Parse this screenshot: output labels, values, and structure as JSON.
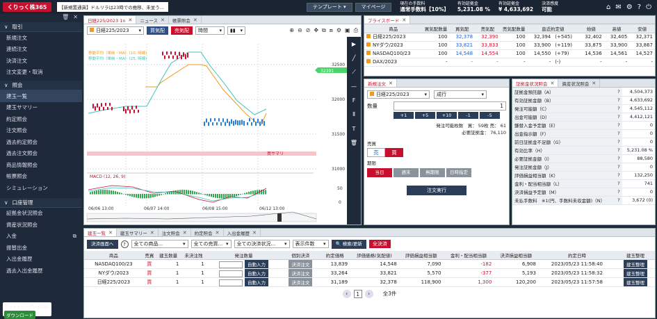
{
  "header": {
    "logo": "くりっく株365",
    "ticker": "【新規置通貨】ドルリラは23時での推移、未並う...",
    "template_btn": "テンプレート ▾",
    "mypage_btn": "マイページ",
    "stats": [
      {
        "label": "現在の手数料",
        "value": "通常手数料【10%】"
      },
      {
        "label": "有効証拠金",
        "value": "5,231.08 %"
      },
      {
        "label": "有効証拠金",
        "value": "¥ 4,633,692"
      },
      {
        "label": "決済感度",
        "value": "可能"
      }
    ]
  },
  "sidebar": {
    "sections": [
      {
        "title": "取引",
        "items": [
          "新規注文",
          "連続注文",
          "決済注文",
          "注文変更・取消"
        ]
      },
      {
        "title": "照会",
        "items": [
          "建玉一覧",
          "建玉サマリー",
          "約定照会",
          "注文照会",
          "過去約定照会",
          "過去注文照会",
          "商品情報照会",
          "帳票照会",
          "シミュレーション"
        ]
      },
      {
        "title": "口座管理",
        "items": [
          "証拠金状況照会",
          "資産状況照会",
          "入金",
          "振替出金",
          "入出金履歴",
          "過去入出金履歴"
        ]
      }
    ],
    "download_title": "ネットトレーダー株365",
    "download_btn": "ダウンロード"
  },
  "chart_panel": {
    "tabs": [
      "日経225/2023 1n",
      "ニュース",
      "帳票照会"
    ],
    "product": "日経225/2023",
    "ask_btn": "買気配",
    "bid_btn": "売気配",
    "period": "時間",
    "legend": [
      "移動平均（単純・MA）（10, 時線)",
      "移動平均（単純・MA）（25, 時線)"
    ],
    "macd_label": "MACD (12, 26, 9)",
    "yticks": [
      "32500",
      "32000",
      "31500",
      "31000"
    ],
    "macd_ticks": [
      "50",
      "0"
    ],
    "xticks": [
      "06/06 13:00",
      "06/07 14:00",
      "06/08 15:00",
      "06/12 13:00"
    ],
    "current_price": "32391",
    "stop_label": "買サマリ"
  },
  "price_board": {
    "tab": "プライスボード",
    "headers": [
      "商品",
      "買気配数量",
      "買気配",
      "売気配",
      "売気配数量",
      "直近約定値",
      "始値",
      "高値",
      "安値"
    ],
    "rows": [
      [
        "日経225/2023",
        "100",
        "32,378",
        "32,390",
        "100",
        "32,394",
        "(+545)",
        "32,402",
        "32,405",
        "32,371"
      ],
      [
        "NYダウ/2023",
        "100",
        "33,821",
        "33,833",
        "100",
        "33,900",
        "(+119)",
        "33,875",
        "33,900",
        "33,867"
      ],
      [
        "NASDAQ100/23",
        "100",
        "14,548",
        "14,554",
        "100",
        "14,550",
        "(+79)",
        "14,536",
        "14,561",
        "14,527"
      ],
      [
        "DAX/2023",
        "-",
        "-",
        "-",
        "-",
        "-",
        "(-)",
        "-",
        "-",
        "-"
      ]
    ]
  },
  "order_panel": {
    "tab": "新規注文",
    "product": "日経225/2023",
    "type": "成行",
    "qty_label": "数量",
    "qty": "1",
    "steps": [
      "+1",
      "+5",
      "+10",
      "-1",
      "-5"
    ],
    "avail_label": "発注可能枚数　買：",
    "avail_value": "59枚 売：",
    "avail_sell": "61",
    "margin_label": "必要証拠金：",
    "margin_value": "76,110",
    "side_label": "売買",
    "sell": "売",
    "buy": "買",
    "expiry_label": "期限",
    "expiry": [
      "当日",
      "週末",
      "無期限",
      "日時指定"
    ],
    "submit": "注文実行"
  },
  "margin_panel": {
    "tabs": [
      "証拠金状況照会",
      "資産状況照会"
    ],
    "rows": [
      [
        "証拠金預託額（A）",
        "4,504,373"
      ],
      [
        "有効証拠金額（B）",
        "4,633,692"
      ],
      [
        "発注可能額（C）",
        "4,545,112"
      ],
      [
        "出金可能額（D）",
        "4,412,121"
      ],
      [
        "鎌替入金予定額（E）",
        "0"
      ],
      [
        "出金指示額（F）",
        "0"
      ],
      [
        "前日証拠金不足額（G）",
        "0"
      ],
      [
        "有効比率（H）",
        "5,231.08 %"
      ],
      [
        "必要証拠金額（I）",
        "88,580"
      ],
      [
        "発注証拠金額（J）",
        "0"
      ],
      [
        "評価損益相当額（K）",
        "132,250"
      ],
      [
        "金利・配当相当額（L）",
        "741"
      ],
      [
        "決済損益予定額（M）",
        "0"
      ],
      [
        "未払手数料　※1(円、手数料未収金額)（N）",
        "3,672 (0)"
      ]
    ]
  },
  "positions": {
    "tabs": [
      "建玉一覧",
      "建玉サマリー",
      "注文照会",
      "約定照会",
      "入出金履歴"
    ],
    "settle_btn": "決済画面へ",
    "filter_product": "全ての商品...",
    "filter_sell": "全ての売買...",
    "filter_settle": "全ての決済状況...",
    "filter_count": "表示件数",
    "search_btn": "検索/更新",
    "close_all": "全決済",
    "headers": [
      "商品",
      "売買",
      "建玉数量",
      "未決注残",
      "発注数量",
      "個別決済",
      "約定価格",
      "評価価格(気配値)",
      "評価損益相当額",
      "金利・配当相当額",
      "決済損益相当額",
      "約定日時",
      "建玉整理"
    ],
    "settle_header": "決済注文",
    "auto_btn": "自動入力",
    "settle_label": "決済注文",
    "organize": "建玉整理",
    "rows": [
      [
        "NASDAQ100/23",
        "買",
        "1",
        "1",
        "13,839",
        "14,548",
        "7,090",
        "-182",
        "6,908",
        "2023/05/23 11:58:40"
      ],
      [
        "NYダウ/2023",
        "買",
        "1",
        "1",
        "33,264",
        "33,821",
        "5,570",
        "-377",
        "5,193",
        "2023/05/23 11:58:32"
      ],
      [
        "日経225/2023",
        "買",
        "1",
        "1",
        "31,189",
        "32,378",
        "118,900",
        "1,300",
        "120,200",
        "2023/05/23 11:57:58"
      ]
    ],
    "page": "1",
    "total": "全3件"
  },
  "colors": {
    "brand": "#c8102e",
    "nav": "#1e2a3a",
    "blue": "#1c5fd0"
  }
}
